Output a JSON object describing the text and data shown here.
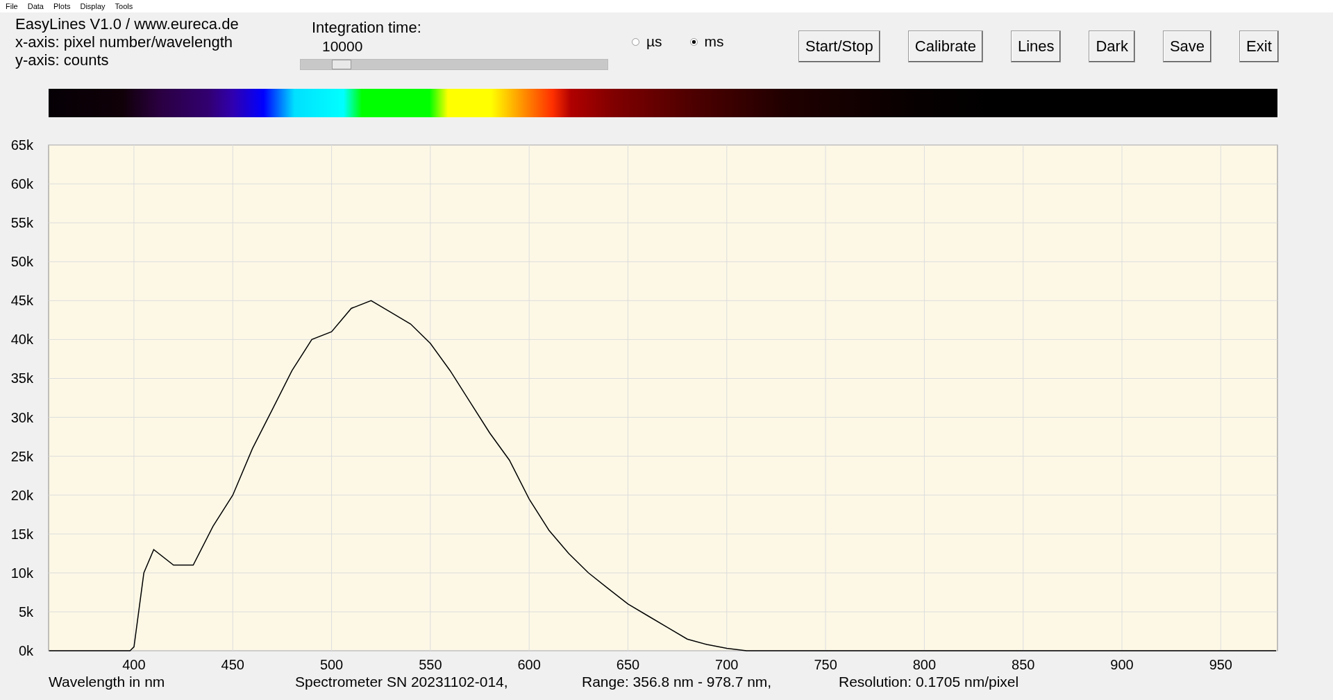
{
  "menu": [
    "File",
    "Data",
    "Plots",
    "Display",
    "Tools"
  ],
  "info_lines": [
    "EasyLines V1.0 / www.eureca.de",
    "x-axis: pixel number/wavelength",
    "y-axis: counts"
  ],
  "integration": {
    "label": "Integration time:",
    "value": "10000",
    "level": 0.13
  },
  "units": [
    {
      "label": "µs",
      "selected": false
    },
    {
      "label": "ms",
      "selected": true
    }
  ],
  "buttons": [
    "Start/Stop",
    "Calibrate",
    "Lines",
    "Dark",
    "Save",
    "Exit"
  ],
  "chart": {
    "chart_data": {
      "type": "line",
      "xlabel": "Wavelength in nm",
      "xlim": [
        356.8,
        978.7
      ],
      "ylim": [
        0,
        65000
      ],
      "xticks": [
        400,
        450,
        500,
        550,
        600,
        650,
        700,
        750,
        800,
        850,
        900,
        950
      ],
      "yticks": [
        {
          "value": 0,
          "label": "0k"
        },
        {
          "value": 5000,
          "label": "5k"
        },
        {
          "value": 10000,
          "label": "10k"
        },
        {
          "value": 15000,
          "label": "15k"
        },
        {
          "value": 20000,
          "label": "20k"
        },
        {
          "value": 25000,
          "label": "25k"
        },
        {
          "value": 30000,
          "label": "30k"
        },
        {
          "value": 35000,
          "label": "35k"
        },
        {
          "value": 40000,
          "label": "40k"
        },
        {
          "value": 45000,
          "label": "45k"
        },
        {
          "value": 50000,
          "label": "50k"
        },
        {
          "value": 55000,
          "label": "55k"
        },
        {
          "value": 60000,
          "label": "60k"
        },
        {
          "value": 65000,
          "label": "65k"
        }
      ],
      "x": [
        357,
        370,
        380,
        390,
        398,
        400,
        405,
        410,
        420,
        430,
        440,
        450,
        460,
        470,
        480,
        490,
        500,
        510,
        520,
        530,
        540,
        550,
        560,
        570,
        580,
        590,
        600,
        610,
        620,
        630,
        640,
        650,
        660,
        670,
        680,
        690,
        700,
        710,
        750,
        800,
        850,
        900,
        950,
        978
      ],
      "grid": true,
      "series": [
        {
          "color": "#000000",
          "values": [
            0,
            0,
            0,
            0,
            0,
            500,
            10000,
            13000,
            11000,
            11000,
            16000,
            20000,
            26000,
            31000,
            36000,
            40000,
            41000,
            44000,
            45000,
            43500,
            42000,
            39500,
            36000,
            32000,
            28000,
            24500,
            19500,
            15500,
            12500,
            10000,
            8000,
            6000,
            4500,
            3000,
            1500,
            800,
            300,
            0,
            0,
            0,
            0,
            0,
            0,
            0
          ]
        }
      ]
    }
  },
  "footer": {
    "spectrometer": "Spectrometer SN 20231102-014,",
    "range": "Range: 356.8 nm - 978.7 nm,",
    "resolution": "Resolution: 0.1705 nm/pixel"
  }
}
